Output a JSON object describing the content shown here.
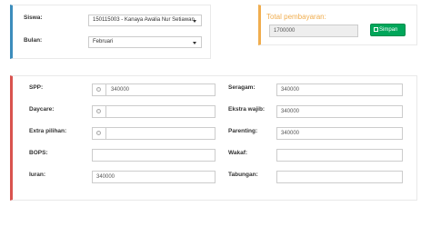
{
  "student": {
    "siswa_label": "Siswa:",
    "siswa_value": "150115003 - Kanaya Awalia Nur Setiawan",
    "bulan_label": "Bulan:",
    "bulan_value": "Februari"
  },
  "payment": {
    "total_label": "Total pembayaran:",
    "total_value": "1700000",
    "save_label": "Simpan"
  },
  "fees": {
    "spp": {
      "label": "SPP:",
      "value": "340000"
    },
    "daycare": {
      "label": "Daycare:",
      "value": ""
    },
    "extra": {
      "label": "Extra pilihan:",
      "value": ""
    },
    "bops": {
      "label": "BOPS:",
      "value": ""
    },
    "iuran": {
      "label": "Iuran:",
      "value": "340000"
    },
    "seragam": {
      "label": "Seragam:",
      "value": "340000"
    },
    "ekstra_wajib": {
      "label": "Ekstra wajib:",
      "value": "340000"
    },
    "parenting": {
      "label": "Parenting:",
      "value": "340000"
    },
    "wakaf": {
      "label": "Wakaf:",
      "value": ""
    },
    "tabungan": {
      "label": "Tabungan:",
      "value": ""
    }
  },
  "colors": {
    "blue_accent": "#3c8dbc",
    "orange_accent": "#f0ad4e",
    "red_accent": "#d9534f",
    "save_button": "#00a65a"
  },
  "icons": {
    "save": "floppy-icon",
    "dropdown": "caret-down-icon"
  }
}
